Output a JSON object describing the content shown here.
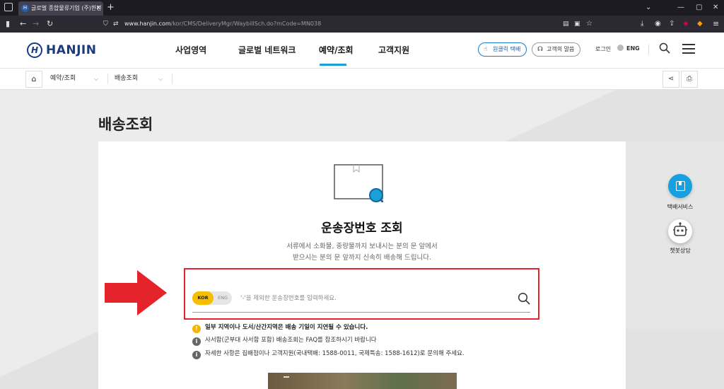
{
  "browser": {
    "tab_title": "글로벌 종합물류기업 (주)한진 -",
    "new_tab": "+",
    "url_domain": "www.hanjin.com",
    "url_path": "/kor/CMS/DeliveryMgr/WaybillSch.do?mCode=MN038",
    "window_controls": [
      "⌄",
      "—",
      "▢",
      "✕"
    ]
  },
  "header": {
    "logo_mark": "H",
    "logo_text": "HANJIN",
    "nav": [
      "사업영역",
      "글로벌 네트워크",
      "예약/조회",
      "고객지원"
    ],
    "active_nav": "예약/조회",
    "pill_oneclick": "원클릭 택배",
    "pill_voice": "고객의 말씀",
    "login": "로그인",
    "lang": "ENG"
  },
  "breadcrumb": {
    "items": [
      "예약/조회",
      "배송조회"
    ]
  },
  "page": {
    "title": "배송조회",
    "heading": "운송장번호 조회",
    "sub1": "서류에서 소화물, 중량물까지 보내시는 분의 문 앞에서",
    "sub2": "받으시는 분의 문 앞까지 신속히 배송해 드립니다."
  },
  "search": {
    "lang_kor": "KOR",
    "lang_eng": "ENG",
    "placeholder": "'-'을 제외한 운송장번호를 입력하세요.",
    "value": ""
  },
  "notices": [
    "일부 지역이나 도서/산간지역은 배송 기일이 지연될 수 있습니다.",
    "사서함(군부대 사서함 포함) 배송조회는 FAQ를 참조하시기 바랍니다",
    "자세한 사항은 집배점이나 고객지원(국내택배: 1588-0011, 국제특송: 1588-1612)로 문의해 주세요."
  ],
  "notice_icons": [
    "!",
    "i",
    "i"
  ],
  "side": {
    "parcel_label": "택배서비스",
    "chatbot_label": "챗봇상담"
  },
  "colors": {
    "brand": "#1a3a82",
    "accent": "#1aa0d8",
    "highlight_red": "#e4232b",
    "kor_yellow": "#f6be00"
  }
}
